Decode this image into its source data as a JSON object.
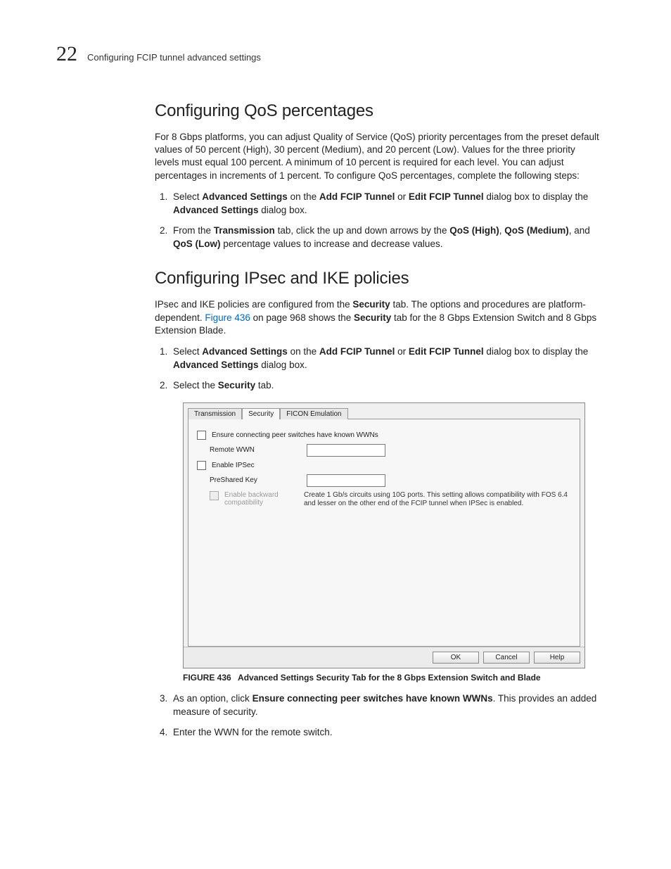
{
  "header": {
    "chapter_number": "22",
    "running_head": "Configuring FCIP tunnel advanced settings"
  },
  "section_qos": {
    "title": "Configuring QoS percentages",
    "intro": "For 8 Gbps platforms, you can adjust Quality of Service (QoS) priority percentages from the preset default values of 50 percent (High), 30 percent (Medium), and 20 percent (Low). Values for the three priority levels must equal 100 percent. A minimum of 10 percent is required for each level. You can adjust percentages in increments of 1 percent. To configure QoS percentages, complete the following steps:",
    "step1_pre": "Select ",
    "step1_b1": "Advanced Settings",
    "step1_mid1": " on the ",
    "step1_b2": "Add FCIP Tunnel",
    "step1_mid2": " or ",
    "step1_b3": "Edit FCIP Tunnel",
    "step1_mid3": " dialog box to display the ",
    "step1_b4": "Advanced Settings",
    "step1_post": " dialog box.",
    "step2_pre": "From the ",
    "step2_b1": "Transmission",
    "step2_mid1": " tab, click the up and down arrows by the ",
    "step2_b2": "QoS (High)",
    "step2_mid2": ", ",
    "step2_b3": "QoS (Medium)",
    "step2_mid3": ", and ",
    "step2_b4": "QoS (Low)",
    "step2_post": " percentage values to increase and decrease values."
  },
  "section_ipsec": {
    "title": "Configuring IPsec and IKE policies",
    "intro_pre": "IPsec and IKE policies are configured from the ",
    "intro_b1": "Security",
    "intro_mid1": " tab. The options and procedures are platform-dependent. ",
    "intro_link": "Figure 436",
    "intro_mid2": " on page 968 shows the ",
    "intro_b2": "Security",
    "intro_post": " tab for the 8 Gbps Extension Switch and 8 Gbps Extension Blade.",
    "step1_pre": "Select ",
    "step1_b1": "Advanced Settings",
    "step1_mid1": " on the ",
    "step1_b2": "Add FCIP Tunnel",
    "step1_mid2": " or ",
    "step1_b3": "Edit FCIP Tunnel",
    "step1_mid3": " dialog box to display the ",
    "step1_b4": "Advanced Settings",
    "step1_post": " dialog box.",
    "step2_pre": "Select the ",
    "step2_b1": "Security",
    "step2_post": " tab.",
    "step3_pre": "As an option, click ",
    "step3_b1": "Ensure connecting peer switches have known WWNs",
    "step3_post": ". This provides an added measure of security.",
    "step4": "Enter the WWN for the remote switch."
  },
  "dialog": {
    "tabs": {
      "t1": "Transmission",
      "t2": "Security",
      "t3": "FICON Emulation"
    },
    "ensure_label": "Ensure connecting peer switches have known WWNs",
    "remote_wwn_label": "Remote WWN",
    "enable_ipsec_label": "Enable IPSec",
    "preshared_label": "PreShared Key",
    "backcompat_label": "Enable backward compatibility",
    "backcompat_desc": "Create 1 Gb/s circuits using 10G ports. This setting allows compatibility with FOS 6.4 and lesser on the other end of the FCIP tunnel when IPSec is enabled.",
    "buttons": {
      "ok": "OK",
      "cancel": "Cancel",
      "help": "Help"
    }
  },
  "figure": {
    "label": "FIGURE 436",
    "title": "Advanced Settings Security Tab for the 8 Gbps Extension Switch and Blade"
  }
}
